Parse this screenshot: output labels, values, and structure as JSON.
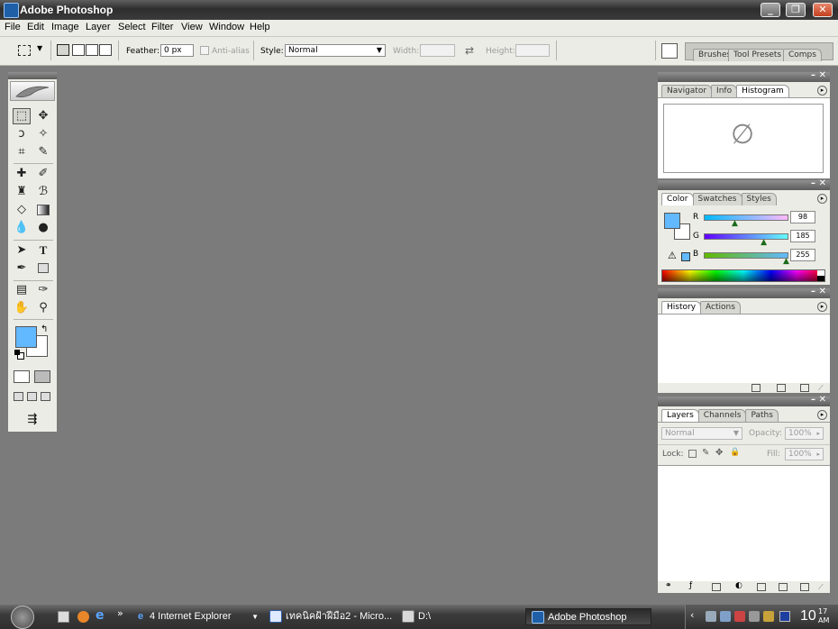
{
  "window": {
    "title": "Adobe Photoshop",
    "minimize": "_",
    "restore": "❐",
    "close": "✕"
  },
  "menu": [
    "File",
    "Edit",
    "Image",
    "Layer",
    "Select",
    "Filter",
    "View",
    "Window",
    "Help"
  ],
  "options": {
    "feather_label": "Feather:",
    "feather_value": "0 px",
    "antialias_label": "Anti-alias",
    "style_label": "Style:",
    "style_value": "Normal",
    "width_label": "Width:",
    "height_label": "Height:",
    "swap_icon": "⇄",
    "well_tabs": [
      "Brushes",
      "Tool Presets",
      "Comps"
    ]
  },
  "navigator": {
    "tabs": [
      "Navigator",
      "Info",
      "Histogram"
    ],
    "empty_symbol": "∅"
  },
  "color": {
    "tabs": [
      "Color",
      "Swatches",
      "Styles"
    ],
    "r_label": "R",
    "g_label": "G",
    "b_label": "B",
    "r": "98",
    "g": "185",
    "b": "255",
    "foreground": "#62b9ff",
    "r_level": 0.38,
    "g_level": 0.73,
    "b_level": 1.0,
    "gamut_icon": "⚠"
  },
  "history": {
    "tabs": [
      "History",
      "Actions"
    ]
  },
  "layers": {
    "tabs": [
      "Layers",
      "Channels",
      "Paths"
    ],
    "blend_value": "Normal",
    "opacity_label": "Opacity:",
    "opacity_value": "100%",
    "lock_label": "Lock:",
    "fill_label": "Fill:",
    "fill_value": "100%"
  },
  "taskbar": {
    "ie_label": "4 Internet Explorer",
    "word_label": "เทคนิคฝ้าฝีมือ2 - Micro...",
    "explorer_label": "D:\\",
    "ps_label": "Adobe Photoshop",
    "clock": "10",
    "clock_minutes": "17",
    "clock_ampm": "AM",
    "more": "»"
  }
}
